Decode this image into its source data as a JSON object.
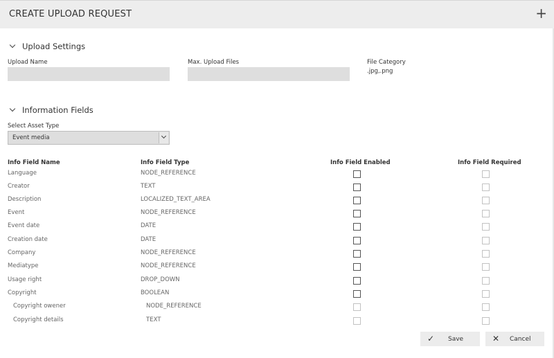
{
  "dialog": {
    "title": "CREATE UPLOAD REQUEST",
    "add_icon": "plus-icon"
  },
  "upload_settings": {
    "header": "Upload Settings",
    "upload_name_label": "Upload Name",
    "upload_name_value": "",
    "max_files_label": "Max. Upload Files",
    "max_files_value": "",
    "file_category_label": "File Category",
    "file_category_value": ".jpg,.png"
  },
  "information_fields": {
    "header": "Information Fields",
    "asset_type_label": "Select Asset Type",
    "asset_type_value": "Event media",
    "columns": {
      "name": "Info Field Name",
      "type": "Info Field Type",
      "enabled": "Info Field Enabled",
      "required": "Info Field Required"
    },
    "rows": [
      {
        "name": "Language",
        "type": "NODE_REFERENCE",
        "enabled": false,
        "required": false
      },
      {
        "name": "Creator",
        "type": "TEXT",
        "enabled": false,
        "required": false
      },
      {
        "name": "Description",
        "type": "LOCALIZED_TEXT_AREA",
        "enabled": false,
        "required": false
      },
      {
        "name": "Event",
        "type": "NODE_REFERENCE",
        "enabled": false,
        "required": false
      },
      {
        "name": "Event date",
        "type": "DATE",
        "enabled": false,
        "required": false
      },
      {
        "name": "Creation date",
        "type": "DATE",
        "enabled": false,
        "required": false
      },
      {
        "name": "Company",
        "type": "NODE_REFERENCE",
        "enabled": false,
        "required": false
      },
      {
        "name": "Mediatype",
        "type": "NODE_REFERENCE",
        "enabled": false,
        "required": false
      },
      {
        "name": "Usage right",
        "type": "DROP_DOWN",
        "enabled": false,
        "required": false
      },
      {
        "name": "Copyright",
        "type": "BOOLEAN",
        "enabled": false,
        "required": false
      },
      {
        "name": "Copyright owener",
        "type": "NODE_REFERENCE",
        "enabled": false,
        "required": false
      },
      {
        "name": "Copyright details",
        "type": "TEXT",
        "enabled": false,
        "required": false
      }
    ]
  },
  "footer": {
    "save_label": "Save",
    "cancel_label": "Cancel"
  }
}
